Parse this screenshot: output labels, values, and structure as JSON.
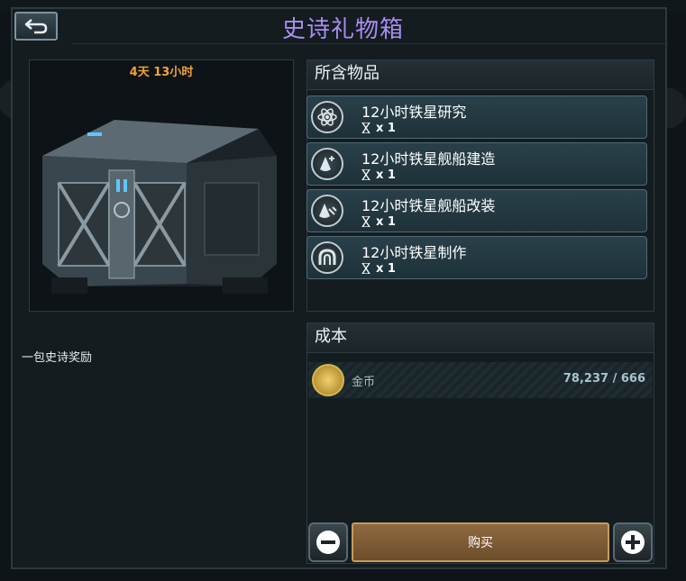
{
  "window": {
    "title": "史诗礼物箱"
  },
  "toolbar": {
    "back_icon": "back-arrow-icon"
  },
  "left": {
    "timer": "4天 13小时",
    "description": "一包史诗奖励"
  },
  "contents": {
    "header": "所含物品",
    "items": [
      {
        "name": "12小时铁星研究",
        "qty": "x 1",
        "icon": "atom-icon"
      },
      {
        "name": "12小时铁星舰船建造",
        "qty": "x 1",
        "icon": "shipbuild-icon"
      },
      {
        "name": "12小时铁星舰船改装",
        "qty": "x 1",
        "icon": "refit-icon"
      },
      {
        "name": "12小时铁星制作",
        "qty": "x 1",
        "icon": "crafting-icon"
      }
    ]
  },
  "cost": {
    "header": "成本",
    "currency_label": "金币",
    "value": "78,237 / 666",
    "icon": "coin-icon"
  },
  "actions": {
    "buy_label": "购买",
    "minus_icon": "minus-icon",
    "plus_icon": "plus-icon"
  },
  "colors": {
    "title": "#a98df0",
    "timer": "#f3a23a",
    "buy": "#8e6a40"
  }
}
